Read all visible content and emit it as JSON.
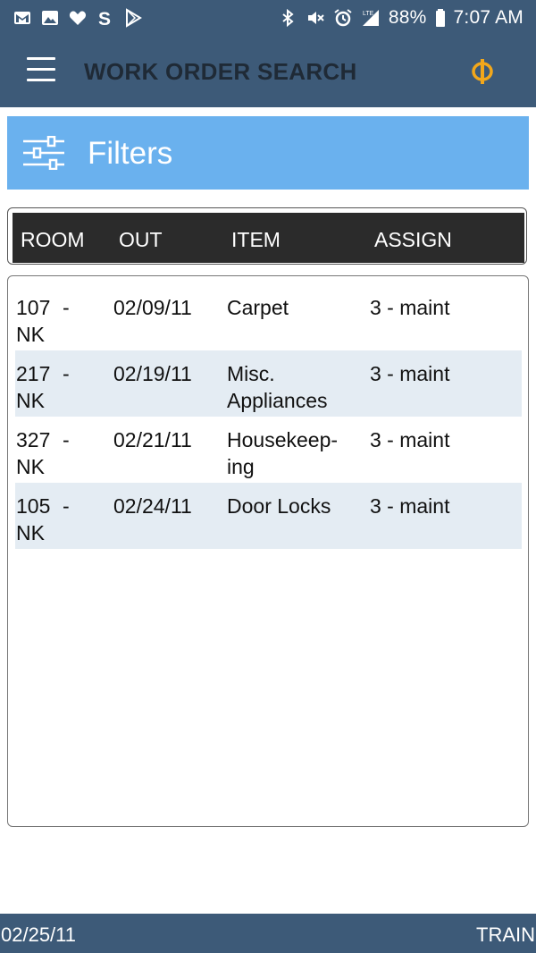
{
  "status_bar": {
    "battery": "88%",
    "time": "7:07 AM",
    "network": "LTE",
    "left_icons": [
      "gmail-icon",
      "gallery-icon",
      "heart-icon",
      "s-app-icon",
      "play-store-icon"
    ],
    "right_icons": [
      "bluetooth-icon",
      "mute-icon",
      "alarm-icon",
      "signal-icon",
      "battery-icon"
    ]
  },
  "app_bar": {
    "title": "WORK ORDER SEARCH",
    "menu_icon": "hamburger-menu-icon",
    "logo_icon": "phi-logo-icon",
    "logo_color": "#f2a71b"
  },
  "filters": {
    "label": "Filters",
    "icon": "sliders-icon"
  },
  "table": {
    "columns": [
      "ROOM",
      "OUT",
      "ITEM",
      "ASSIGN"
    ],
    "rows": [
      {
        "room_num": "107",
        "room_dash": "-",
        "room_code": "NK",
        "out": "02/09/11",
        "item_line1": "Carpet",
        "item_line2": "",
        "assign": "3 - maint"
      },
      {
        "room_num": "217",
        "room_dash": "-",
        "room_code": "NK",
        "out": "02/19/11",
        "item_line1": "Misc.",
        "item_line2": "Appliances",
        "assign": "3 - maint"
      },
      {
        "room_num": "327",
        "room_dash": "-",
        "room_code": "NK",
        "out": "02/21/11",
        "item_line1": "Housekeep-",
        "item_line2": "ing",
        "assign": "3 - maint"
      },
      {
        "room_num": "105",
        "room_dash": "-",
        "room_code": "NK",
        "out": "02/24/11",
        "item_line1": "Door Locks",
        "item_line2": "",
        "assign": "3 - maint"
      }
    ]
  },
  "footer": {
    "date": "02/25/11",
    "mode": "TRAIN"
  },
  "colors": {
    "header_bg": "#3d5a78",
    "filters_bg": "#6ab1ee",
    "table_header_bg": "#2b2b2b",
    "alt_row_bg": "#e4ecf3"
  }
}
